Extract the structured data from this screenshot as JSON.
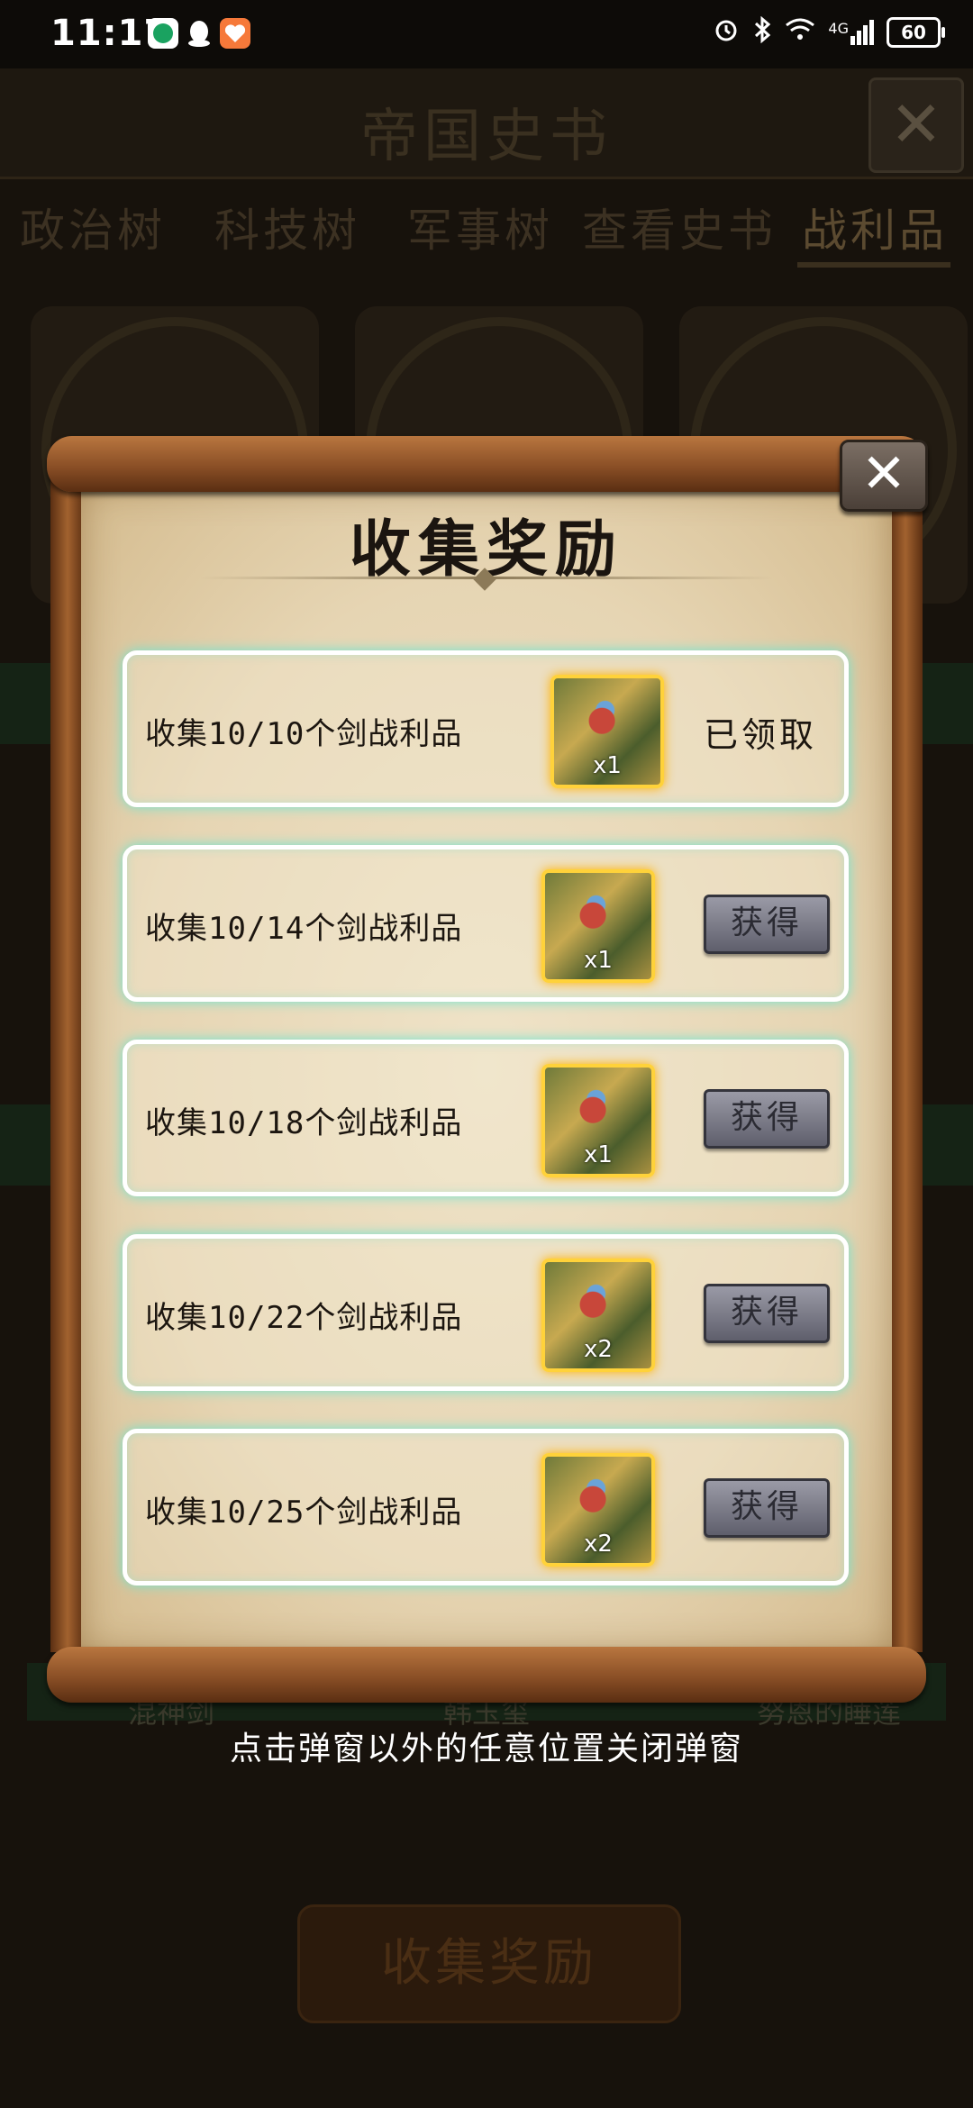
{
  "status_bar": {
    "time": "11:17",
    "signal_label": "4G",
    "battery": "60"
  },
  "background": {
    "title": "帝国史书",
    "tabs": [
      "政治树",
      "科技树",
      "军事树",
      "查看史书",
      "战利品"
    ],
    "active_tab": "战利品",
    "item_labels": [
      "混神剑",
      "韩玉玺",
      "努恩的睡莲"
    ],
    "bottom_button": "收集奖励"
  },
  "modal": {
    "title": "收集奖励",
    "close_icon": "close-icon",
    "rewards": [
      {
        "desc": "收集10/10个剑战利品",
        "qty": "x1",
        "status": "已领取",
        "action": ""
      },
      {
        "desc": "收集10/14个剑战利品",
        "qty": "x1",
        "status": "",
        "action": "获得"
      },
      {
        "desc": "收集10/18个剑战利品",
        "qty": "x1",
        "status": "",
        "action": "获得"
      },
      {
        "desc": "收集10/22个剑战利品",
        "qty": "x2",
        "status": "",
        "action": "获得"
      },
      {
        "desc": "收集10/25个剑战利品",
        "qty": "x2",
        "status": "",
        "action": "获得"
      }
    ]
  },
  "hint": "点击弹窗以外的任意位置关闭弹窗",
  "colors": {
    "row_glow": "#6fe3d0",
    "icon_border": "#ffd23a",
    "scroll_wood": "#8a4f26",
    "parchment": "#e6d5b3"
  }
}
